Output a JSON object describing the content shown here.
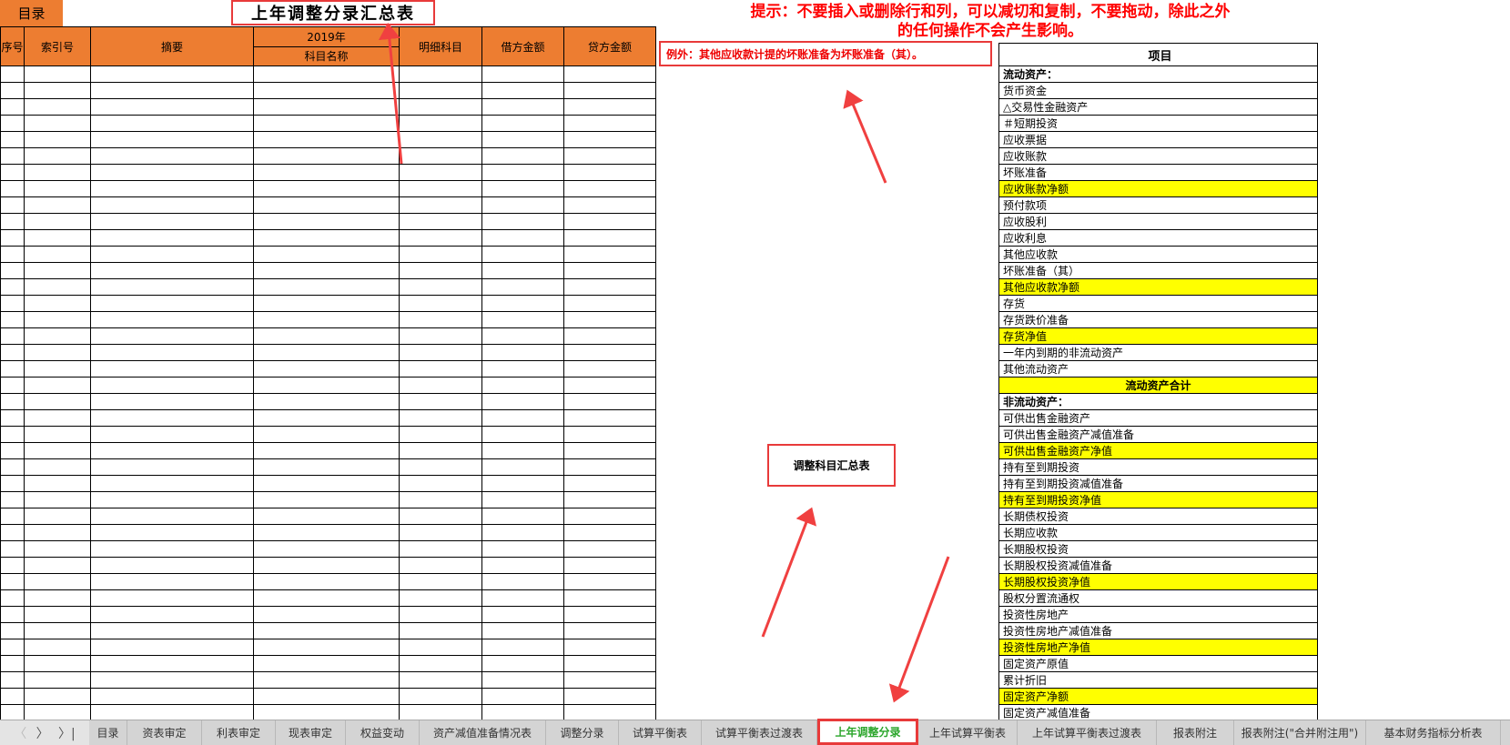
{
  "catalog_button": "目录",
  "title": "上年调整分录汇总表",
  "left_table": {
    "headers": [
      "序号",
      "索引号",
      "摘要",
      "2019年",
      "科目名称",
      "明细科目",
      "借方金额",
      "贷方金额"
    ],
    "row_count": 40
  },
  "hint": {
    "line1": "提示：不要插入或删除行和列，可以减切和复制，不要拖动，除此之外",
    "line2": "的任何操作不会产生影响。"
  },
  "exception": "例外：其他应收款计提的坏账准备为坏账准备（其）。",
  "summary_box": "调整科目汇总表",
  "right_table": {
    "header": "项目",
    "rows": [
      {
        "label": "流动资产：",
        "style": "b"
      },
      {
        "label": "货币资金"
      },
      {
        "label": "△交易性金融资产"
      },
      {
        "label": "＃短期投资"
      },
      {
        "label": "应收票据"
      },
      {
        "label": "应收账款"
      },
      {
        "label": "坏账准备"
      },
      {
        "label": "应收账款净额",
        "style": "y"
      },
      {
        "label": "预付款项"
      },
      {
        "label": "应收股利"
      },
      {
        "label": "应收利息"
      },
      {
        "label": "其他应收款"
      },
      {
        "label": "坏账准备（其）"
      },
      {
        "label": "其他应收款净额",
        "style": "y"
      },
      {
        "label": "存货"
      },
      {
        "label": "存货跌价准备"
      },
      {
        "label": "存货净值",
        "style": "y"
      },
      {
        "label": "一年内到期的非流动资产"
      },
      {
        "label": "其他流动资产"
      },
      {
        "label": "流动资产合计",
        "style": "y b c"
      },
      {
        "label": "非流动资产：",
        "style": "b"
      },
      {
        "label": "可供出售金融资产"
      },
      {
        "label": "可供出售金融资产减值准备"
      },
      {
        "label": "可供出售金融资产净值",
        "style": "y"
      },
      {
        "label": "持有至到期投资"
      },
      {
        "label": "持有至到期投资减值准备"
      },
      {
        "label": "持有至到期投资净值",
        "style": "y"
      },
      {
        "label": "长期债权投资"
      },
      {
        "label": "长期应收款"
      },
      {
        "label": "长期股权投资"
      },
      {
        "label": "长期股权投资减值准备"
      },
      {
        "label": "长期股权投资净值",
        "style": "y"
      },
      {
        "label": "股权分置流通权"
      },
      {
        "label": "投资性房地产"
      },
      {
        "label": "投资性房地产减值准备"
      },
      {
        "label": "投资性房地产净值",
        "style": "y"
      },
      {
        "label": "固定资产原值"
      },
      {
        "label": "累计折旧"
      },
      {
        "label": "固定资产净额",
        "style": "y"
      },
      {
        "label": "固定资产减值准备"
      }
    ]
  },
  "tabs": [
    {
      "label": "目录"
    },
    {
      "label": "资表审定"
    },
    {
      "label": "利表审定"
    },
    {
      "label": "现表审定"
    },
    {
      "label": "权益变动"
    },
    {
      "label": "资产减值准备情况表"
    },
    {
      "label": "调整分录"
    },
    {
      "label": "试算平衡表"
    },
    {
      "label": "试算平衡表过渡表"
    },
    {
      "label": "上年调整分录",
      "active": true
    },
    {
      "label": "上年试算平衡表"
    },
    {
      "label": "上年试算平衡表过渡表"
    },
    {
      "label": "报表附注"
    },
    {
      "label": "报表附注(\"合并附注用\")"
    },
    {
      "label": "基本财务指标分析表"
    }
  ],
  "nav": {
    "prev": "〈",
    "next": "〉",
    "last": "〉|"
  },
  "colors": {
    "header_orange": "#ED7D31",
    "highlight_yellow": "#FFFF00",
    "annotation_red": "#E83A3A",
    "active_tab_green": "#2AA52A"
  }
}
